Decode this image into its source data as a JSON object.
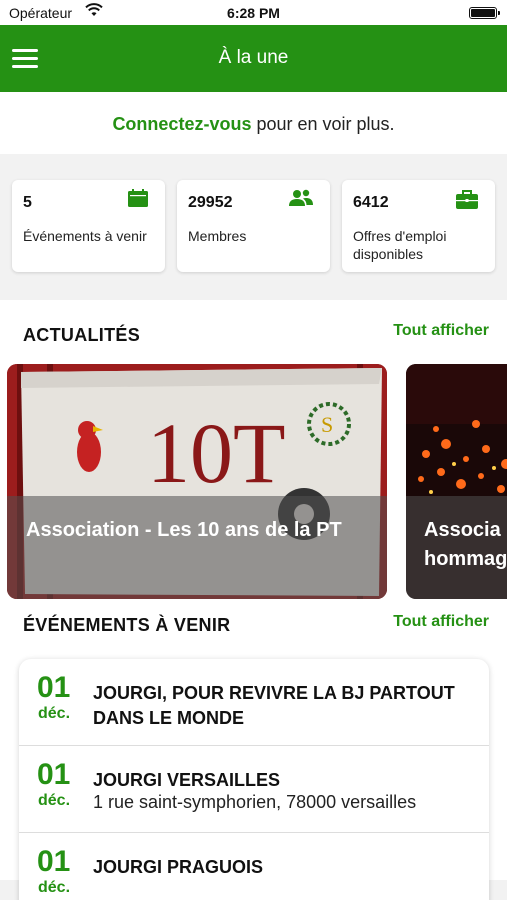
{
  "status": {
    "carrier": "Opérateur",
    "time": "6:28 PM"
  },
  "header": {
    "title": "À la une"
  },
  "login": {
    "link": "Connectez-vous",
    "rest": " pour en voir plus."
  },
  "stats": [
    {
      "value": "5",
      "label": "Événements à venir",
      "icon": "calendar-icon"
    },
    {
      "value": "29952",
      "label": "Membres",
      "icon": "members-icon"
    },
    {
      "value": "6412",
      "label": "Offres d'emploi disponibles",
      "icon": "briefcase-icon"
    }
  ],
  "news": {
    "title": "ACTUALITÉS",
    "see_all": "Tout afficher",
    "items": [
      {
        "title": "Association - Les 10 ans de la PT",
        "image_text": "10T"
      },
      {
        "title": "Associa\nhommag"
      }
    ]
  },
  "events": {
    "title": "ÉVÉNEMENTS À VENIR",
    "see_all": "Tout afficher",
    "items": [
      {
        "day": "01",
        "month": "déc.",
        "title": "JOURGI, POUR REVIVRE LA BJ PARTOUT DANS LE MONDE",
        "subtitle": ""
      },
      {
        "day": "01",
        "month": "déc.",
        "title": "JOURGI VERSAILLES",
        "subtitle": "1 rue saint-symphorien, 78000 versailles"
      },
      {
        "day": "01",
        "month": "déc.",
        "title": "JOURGI PRAGUOIS",
        "subtitle": ""
      }
    ]
  },
  "colors": {
    "accent": "#259114"
  }
}
